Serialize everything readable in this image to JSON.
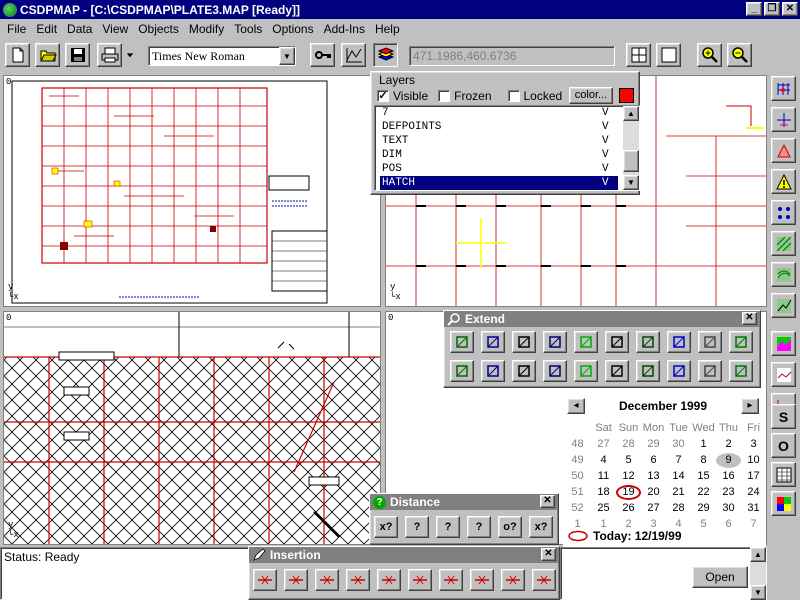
{
  "window": {
    "title": "CSDPMAP - [C:\\CSDPMAP\\PLATE3.MAP [Ready]]",
    "min": "_",
    "restore": "❐",
    "close": "✕"
  },
  "menu": [
    "File",
    "Edit",
    "Data",
    "View",
    "Objects",
    "Modify",
    "Tools",
    "Options",
    "Add-Ins",
    "Help"
  ],
  "toolbar": {
    "font": "Times New Roman",
    "coordinates": "471.1986,460.6736"
  },
  "panes": [
    {
      "number": "0",
      "axis_y": "y",
      "axis_x": "x"
    },
    {
      "number": "0",
      "axis_y": "y",
      "axis_x": "x"
    },
    {
      "number": "0",
      "axis_y": "y",
      "axis_x": "x"
    },
    {
      "number": "0"
    }
  ],
  "layers": {
    "title": "Layers",
    "visible_label": "Visible",
    "frozen_label": "Frozen",
    "locked_label": "Locked",
    "color_button": "color...",
    "color_swatch": "#ff0000",
    "rows": [
      {
        "name": "7",
        "flag": "V"
      },
      {
        "name": "DEFPOINTS",
        "flag": "V"
      },
      {
        "name": "TEXT",
        "flag": "V"
      },
      {
        "name": "DIM",
        "flag": "V"
      },
      {
        "name": "POS",
        "flag": "V"
      },
      {
        "name": "HATCH",
        "flag": "V",
        "selected": true
      }
    ]
  },
  "extend": {
    "title": "Extend",
    "close": "✕"
  },
  "distance": {
    "title": "Distance",
    "close": "✕",
    "buttons": [
      "x?",
      "?",
      "?",
      "?",
      "o?",
      "x?"
    ]
  },
  "insertion": {
    "title": "Insertion",
    "close": "✕"
  },
  "calendar": {
    "month": "December 1999",
    "prev": "◂",
    "next": "▸",
    "days": [
      "Sat",
      "Sun",
      "Mon",
      "Tue",
      "Wed",
      "Thu",
      "Fri"
    ],
    "weeks": [
      {
        "wk": "48",
        "dates": [
          "27",
          "28",
          "29",
          "30",
          "1",
          "2",
          "3"
        ]
      },
      {
        "wk": "49",
        "dates": [
          "4",
          "5",
          "6",
          "7",
          "8",
          "9",
          "10"
        ]
      },
      {
        "wk": "50",
        "dates": [
          "11",
          "12",
          "13",
          "14",
          "15",
          "16",
          "17"
        ]
      },
      {
        "wk": "51",
        "dates": [
          "18",
          "19",
          "20",
          "21",
          "22",
          "23",
          "24"
        ]
      },
      {
        "wk": "52",
        "dates": [
          "25",
          "26",
          "27",
          "28",
          "29",
          "30",
          "31"
        ]
      },
      {
        "wk": "1",
        "dates": [
          "1",
          "2",
          "3",
          "4",
          "5",
          "6",
          "7"
        ]
      }
    ],
    "today_label": "Today: 12/19/99"
  },
  "status": {
    "text": "Status: Ready"
  },
  "open_button": "Open",
  "right_toolbar": {
    "s": "S",
    "o": "O"
  }
}
